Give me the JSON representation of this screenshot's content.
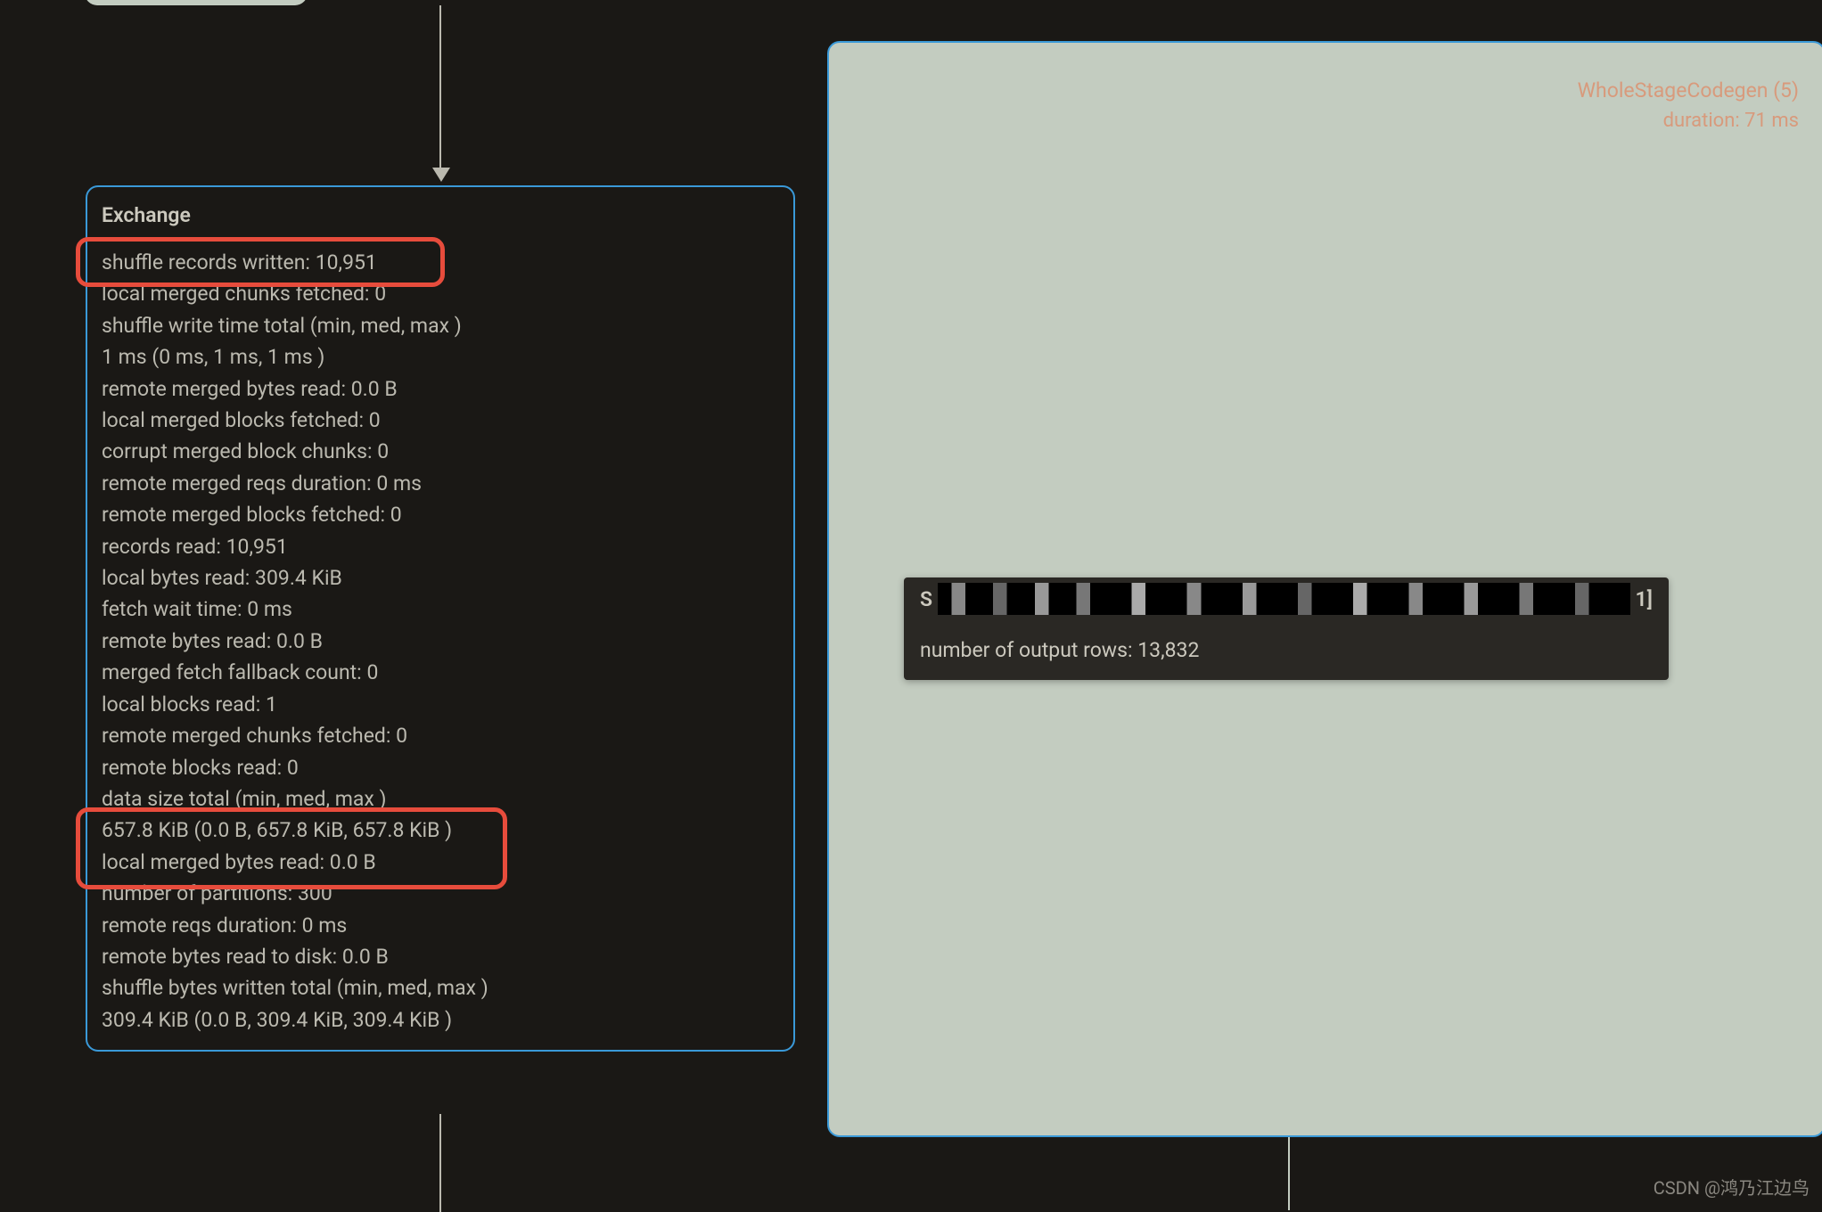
{
  "exchange": {
    "title": "Exchange",
    "metrics": [
      "shuffle records written: 10,951",
      "local merged chunks fetched: 0",
      "shuffle write time total (min, med, max )",
      "1 ms (0 ms, 1 ms, 1 ms )",
      "remote merged bytes read: 0.0 B",
      "local merged blocks fetched: 0",
      "corrupt merged block chunks: 0",
      "remote merged reqs duration: 0 ms",
      "remote merged blocks fetched: 0",
      "records read: 10,951",
      "local bytes read: 309.4 KiB",
      "fetch wait time: 0 ms",
      "remote bytes read: 0.0 B",
      "merged fetch fallback count: 0",
      "local blocks read: 1",
      "remote merged chunks fetched: 0",
      "remote blocks read: 0",
      "data size total (min, med, max )",
      "657.8 KiB (0.0 B, 657.8 KiB, 657.8 KiB )",
      "local merged bytes read: 0.0 B",
      "number of partitions: 300",
      "remote reqs duration: 0 ms",
      "remote bytes read to disk: 0.0 B",
      "shuffle bytes written total (min, med, max )",
      "309.4 KiB (0.0 B, 309.4 KiB, 309.4 KiB )"
    ]
  },
  "rightPanel": {
    "title": "WholeStageCodegen (5)",
    "subtitle": "duration: 71 ms"
  },
  "tooltip": {
    "prefix": "S",
    "suffix": "1]",
    "metric": "number of output rows: 13,832"
  },
  "watermark": "CSDN @鸿乃江边鸟"
}
